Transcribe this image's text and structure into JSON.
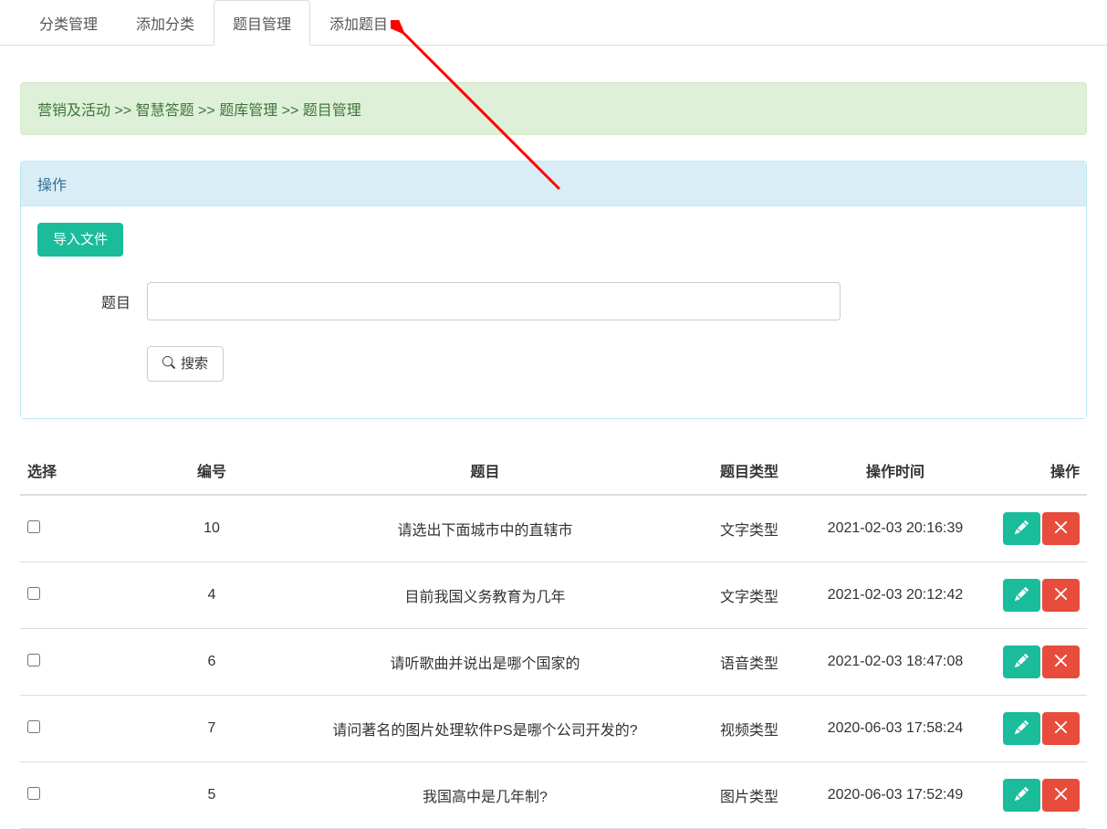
{
  "tabs": [
    {
      "label": "分类管理",
      "active": false
    },
    {
      "label": "添加分类",
      "active": false
    },
    {
      "label": "题目管理",
      "active": true
    },
    {
      "label": "添加题目",
      "active": false
    }
  ],
  "breadcrumb": {
    "items": [
      "营销及活动",
      "智慧答题",
      "题库管理",
      "题目管理"
    ],
    "separator": " >> "
  },
  "panel": {
    "title": "操作",
    "import_button_label": "导入文件",
    "form_label": "题目",
    "form_value": "",
    "search_button_label": "搜索"
  },
  "table": {
    "columns": [
      "选择",
      "编号",
      "题目",
      "题目类型",
      "操作时间",
      "操作"
    ],
    "rows": [
      {
        "id": "10",
        "title": "请选出下面城市中的直辖市",
        "type": "文字类型",
        "time": "2021-02-03 20:16:39"
      },
      {
        "id": "4",
        "title": "目前我国义务教育为几年",
        "type": "文字类型",
        "time": "2021-02-03 20:12:42"
      },
      {
        "id": "6",
        "title": "请听歌曲并说出是哪个国家的",
        "type": "语音类型",
        "time": "2021-02-03 18:47:08"
      },
      {
        "id": "7",
        "title": "请问著名的图片处理软件PS是哪个公司开发的?",
        "type": "视频类型",
        "time": "2020-06-03 17:58:24"
      },
      {
        "id": "5",
        "title": "我国高中是几年制?",
        "type": "图片类型",
        "time": "2020-06-03 17:52:49"
      }
    ]
  },
  "icons": {
    "edit": "edit-icon",
    "delete": "close-icon",
    "search": "search-icon"
  }
}
